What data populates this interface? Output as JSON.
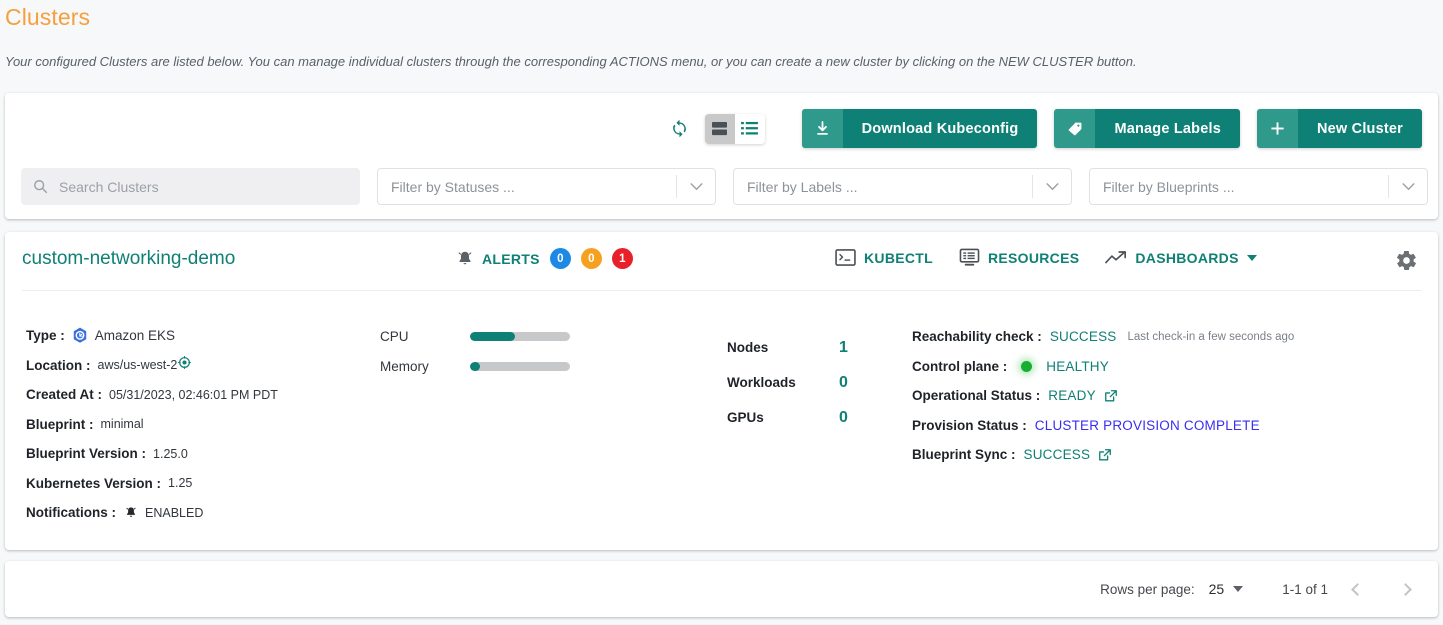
{
  "header": {
    "title": "Clusters",
    "description": "Your configured Clusters are listed below. You can manage individual clusters through the corresponding ACTIONS menu, or you can create a new cluster by clicking on the NEW CLUSTER button."
  },
  "toolbar": {
    "refresh_icon": "refresh-icon",
    "view_card_icon": "card-view-icon",
    "view_list_icon": "list-view-icon",
    "buttons": [
      {
        "label": "Download Kubeconfig",
        "icon": "download-icon"
      },
      {
        "label": "Manage Labels",
        "icon": "tag-icon"
      },
      {
        "label": "New Cluster",
        "icon": "plus-icon"
      }
    ]
  },
  "filters": {
    "search_placeholder": "Search Clusters",
    "search_value": "",
    "status_label": "Filter by Statuses ...",
    "labels_label": "Filter by Labels ...",
    "blueprints_label": "Filter by Blueprints ..."
  },
  "cluster": {
    "name": "custom-networking-demo",
    "alerts": {
      "label": "ALERTS",
      "info": "0",
      "warning": "0",
      "critical": "1"
    },
    "links": [
      {
        "label": "KUBECTL",
        "icon": "terminal-icon"
      },
      {
        "label": "RESOURCES",
        "icon": "resources-icon"
      },
      {
        "label": "DASHBOARDS",
        "icon": "trending-up-icon"
      }
    ],
    "settings_icon": "gear-icon",
    "details": [
      {
        "key": "Type :",
        "value": "Amazon EKS",
        "icon": "kubernetes-icon"
      },
      {
        "key": "Location :",
        "value": "aws/us-west-2",
        "icon": "location-target-icon"
      },
      {
        "key": "Created At :",
        "value": "05/31/2023, 02:46:01 PM PDT"
      },
      {
        "key": "Blueprint :",
        "value": "minimal"
      },
      {
        "key": "Blueprint Version :",
        "value": "1.25.0"
      },
      {
        "key": "Kubernetes Version :",
        "value": "1.25"
      },
      {
        "key": "Notifications :",
        "value": "ENABLED",
        "icon": "bell-icon"
      }
    ],
    "metrics": [
      {
        "name": "CPU",
        "percent": 45
      },
      {
        "name": "Memory",
        "percent": 10
      }
    ],
    "counts": [
      {
        "name": "Nodes",
        "value": "1"
      },
      {
        "name": "Workloads",
        "value": "0"
      },
      {
        "name": "GPUs",
        "value": "0"
      }
    ],
    "statuses": [
      {
        "key": "Reachability check :",
        "value": "SUCCESS",
        "note": "Last check-in  a few seconds ago"
      },
      {
        "key": "Control plane :",
        "value": "HEALTHY",
        "dot": true
      },
      {
        "key": "Operational Status :",
        "value": "READY",
        "external": true
      },
      {
        "key": "Provision Status :",
        "value": "CLUSTER PROVISION COMPLETE",
        "accent": "blue"
      },
      {
        "key": "Blueprint Sync :",
        "value": "SUCCESS",
        "external": true
      }
    ]
  },
  "footer": {
    "rows_per_page_label": "Rows per page:",
    "rows_per_page_value": "25",
    "range": "1-1 of 1",
    "prev_icon": "chevron-left-icon",
    "next_icon": "chevron-right-icon"
  },
  "colors": {
    "accent_teal": "#0f8075",
    "title_orange": "#f5a03c",
    "blue": "#3a2df0",
    "alert_info": "#1e88e5",
    "alert_warning": "#f5a11f",
    "alert_critical": "#e8202a",
    "healthy_green": "#16b030"
  }
}
